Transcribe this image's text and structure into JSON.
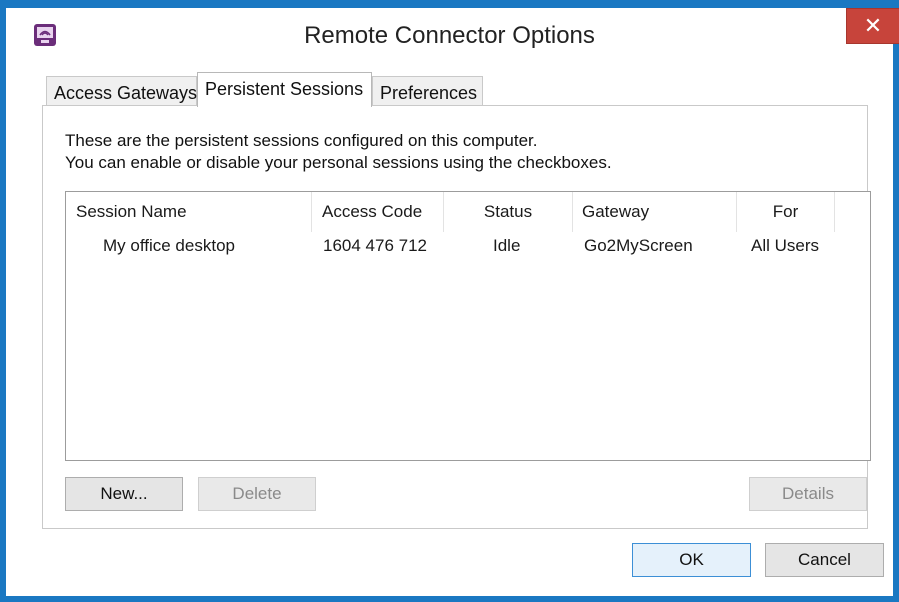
{
  "window": {
    "title": "Remote Connector Options",
    "close_label": "✕",
    "accent_color": "#1a78c2",
    "close_color": "#c7443b"
  },
  "tabs": [
    {
      "label": "Access Gateways",
      "active": false
    },
    {
      "label": "Persistent Sessions",
      "active": true
    },
    {
      "label": "Preferences",
      "active": false
    }
  ],
  "panel": {
    "description_line1": "These are the persistent sessions configured on this computer.",
    "description_line2": "You can enable or disable your personal sessions using the checkboxes."
  },
  "table": {
    "columns": [
      "Session Name",
      "Access Code",
      "Status",
      "Gateway",
      "For"
    ],
    "rows": [
      {
        "session_name": "My office desktop",
        "access_code": "1604 476 712",
        "status": "Idle",
        "gateway": "Go2MyScreen",
        "for": "All Users"
      }
    ]
  },
  "buttons": {
    "new": "New...",
    "delete": "Delete",
    "details": "Details",
    "ok": "OK",
    "cancel": "Cancel"
  },
  "icons": {
    "app": "remote-connector-icon",
    "close": "close-icon"
  }
}
